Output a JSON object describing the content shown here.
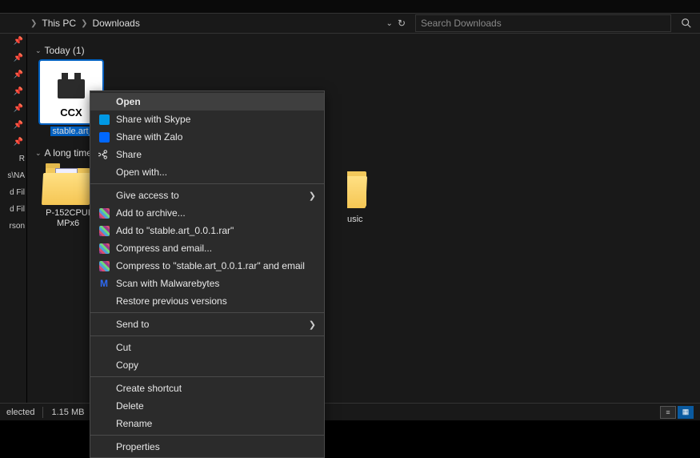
{
  "toolbar": {},
  "breadcrumb": {
    "items": [
      {
        "label": "This PC"
      },
      {
        "label": "Downloads"
      }
    ]
  },
  "search": {
    "placeholder": "Search Downloads"
  },
  "nav_items": [
    {
      "label": "R"
    },
    {
      "label": "s\\NA"
    },
    {
      "label": "d Fil"
    },
    {
      "label": "d Fil"
    },
    {
      "label": "rson"
    }
  ],
  "groups": [
    {
      "header": "Today (1)"
    },
    {
      "header": "A long time"
    }
  ],
  "selected_file": {
    "ext": "CCX",
    "label": "stable.art_"
  },
  "folder1": {
    "line1": "P-152CPUI",
    "line2": "MPx6"
  },
  "partial_folder": {
    "label": "usic"
  },
  "context_menu": {
    "open": "Open",
    "share_skype": "Share with Skype",
    "share_zalo": "Share with Zalo",
    "share": "Share",
    "open_with": "Open with...",
    "give_access": "Give access to",
    "add_archive": "Add to archive...",
    "add_to_rar": "Add to \"stable.art_0.0.1.rar\"",
    "compress_email": "Compress and email...",
    "compress_to": "Compress to \"stable.art_0.0.1.rar\" and email",
    "scan_mwb": "Scan with Malwarebytes",
    "restore_prev": "Restore previous versions",
    "send_to": "Send to",
    "cut": "Cut",
    "copy": "Copy",
    "create_shortcut": "Create shortcut",
    "delete": "Delete",
    "rename": "Rename",
    "properties": "Properties"
  },
  "statusbar": {
    "selected": "elected",
    "size": "1.15 MB"
  }
}
